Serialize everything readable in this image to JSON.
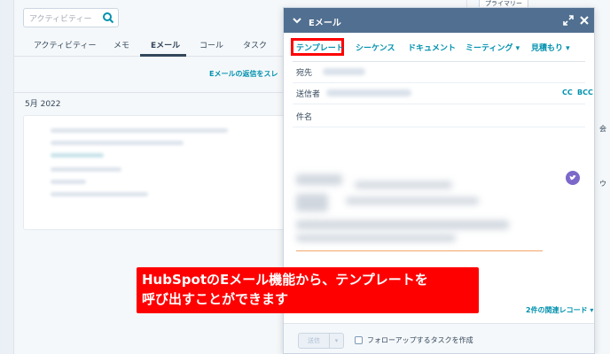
{
  "search": {
    "placeholder": "アクティビティー"
  },
  "tabs": [
    {
      "label": "アクティビティー"
    },
    {
      "label": "メモ"
    },
    {
      "label": "Eメール"
    },
    {
      "label": "コール"
    },
    {
      "label": "タスク"
    }
  ],
  "email_thread_link": "Eメールの返信をスレ",
  "month_header": "5月 2022",
  "sidebar": {
    "primary_tag": "プライマリー"
  },
  "modal": {
    "title": "Eメール",
    "toolbar": [
      {
        "label": "テンプレート"
      },
      {
        "label": "シーケンス"
      },
      {
        "label": "ドキュメント"
      },
      {
        "label": "ミーティング ▾"
      },
      {
        "label": "見積もり ▾"
      }
    ],
    "to_label": "宛先",
    "from_label": "送信者",
    "cc_label": "CC",
    "bcc_label": "BCC",
    "subject_label": "件名",
    "related_records": "2件の関連レコード ▾",
    "send_label": "送信",
    "followup_label": "フォローアップするタスクを作成"
  },
  "callout": {
    "line1": "HubSpotのEメール機能から、テンプレートを",
    "line2": "呼び出すことができます"
  },
  "colors": {
    "header": "#516f90",
    "link": "#0091ae",
    "highlight": "#ff0000",
    "callout_bg": "#ff0000"
  }
}
